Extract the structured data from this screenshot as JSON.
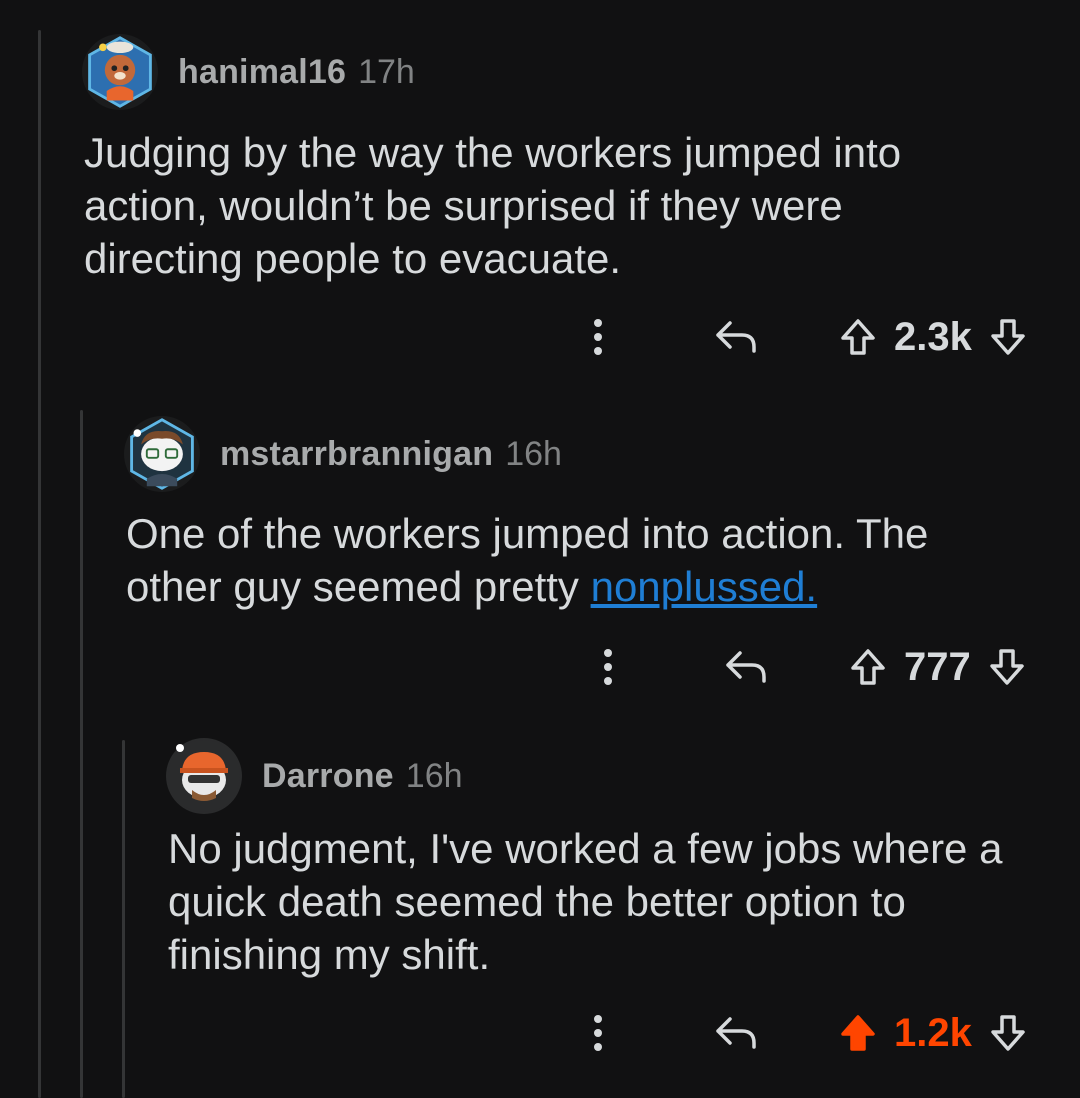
{
  "comments": [
    {
      "username": "hanimal16",
      "time": "17h",
      "body": "Judging by the way the workers jumped into action, wouldn’t be surprised if they were directing people to evacuate.",
      "score": "2.3k",
      "upvoted": false,
      "avatar_icon": "red-panda-avatar-icon"
    },
    {
      "username": "mstarrbrannigan",
      "time": "16h",
      "body_prefix": "One of the workers jumped into action. The other guy seemed pretty ",
      "body_link": "nonplussed.",
      "score": "777",
      "upvoted": false,
      "avatar_icon": "snoo-glasses-avatar-icon"
    },
    {
      "username": "Darrone",
      "time": "16h",
      "body": "No judgment, I've worked a few jobs where a quick death seemed the better option to finishing my shift.",
      "score": "1.2k",
      "upvoted": true,
      "avatar_icon": "snoo-hardhat-avatar-icon"
    }
  ],
  "colors": {
    "background": "#111112",
    "text": "#d7dadc",
    "muted": "#818384",
    "link": "#1f7ed4",
    "upvote": "#ff4500",
    "thread_line": "#343536"
  }
}
